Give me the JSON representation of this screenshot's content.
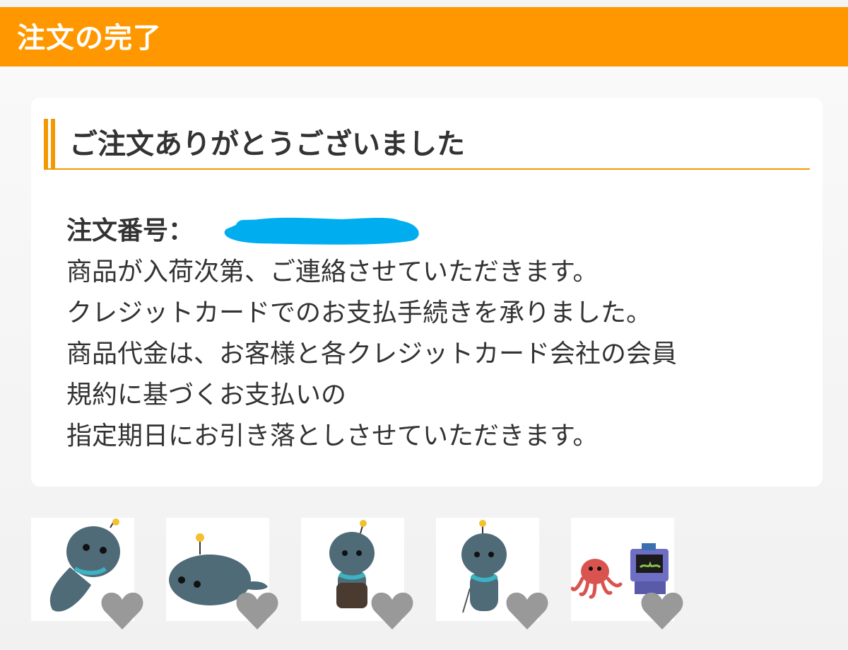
{
  "header": {
    "title": "注文の完了"
  },
  "card": {
    "heading": "ご注文ありがとうございました",
    "order_label": "注文番号：",
    "messages": [
      "商品が入荷次第、ご連絡させていただきます。",
      "クレジットカードでのお支払手続きを承りました。",
      "商品代金は、お客様と各クレジットカード会社の会員",
      "規約に基づくお支払いの",
      "指定期日にお引き落としさせていただきます。"
    ]
  },
  "thumbnails": [
    {
      "icon": "character-lying-icon",
      "favorite_icon": "heart-icon"
    },
    {
      "icon": "seal-character-icon",
      "favorite_icon": "heart-icon"
    },
    {
      "icon": "character-apron-icon",
      "favorite_icon": "heart-icon"
    },
    {
      "icon": "character-scarf-icon",
      "favorite_icon": "heart-icon"
    },
    {
      "icon": "octopus-robot-icon",
      "favorite_icon": "heart-icon"
    }
  ],
  "colors": {
    "header": "#ff9800",
    "accent": "#f39800",
    "redaction": "#00aeef",
    "heart": "#999999",
    "character": "#4f6b78"
  }
}
